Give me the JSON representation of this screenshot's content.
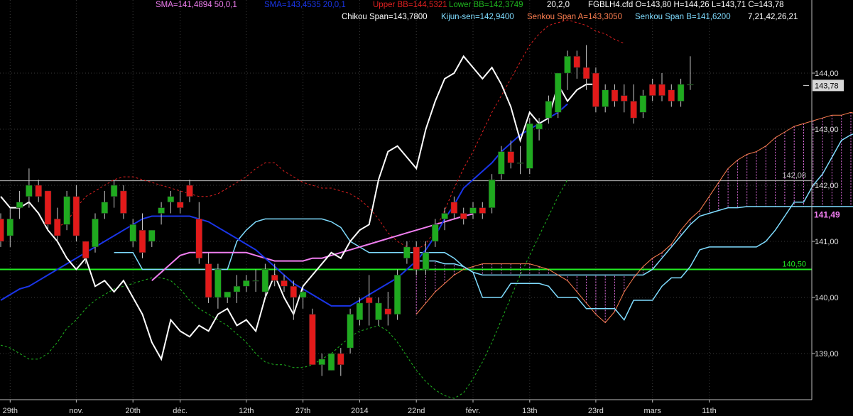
{
  "header": {
    "sma1": "SMA=141,4894  50,0,1",
    "sma2": "SMA=143,4535  20,0,1",
    "upper_bb": "Upper BB=144,5321",
    "lower_bb": "Lower BB=142,3749",
    "bb_params": "20,2,0",
    "ohlc": "FGBLH4.cfd O=143,80 H=144,26 L=143,71 C=143,78",
    "chikou": "Chikou Span=143,7800",
    "kijun": "Kijun-sen=142,9400",
    "senkou_a": "Senkou Span A=143,3050",
    "senkou_b": "Senkou Span B=141,6200",
    "ichimoku_params": "7,21,42,26,21"
  },
  "colors": {
    "background": "#000000",
    "up_candle": "#1faa1f",
    "down_candle": "#e21a1a",
    "sma50": "#f07ef0",
    "sma20": "#1a35e8",
    "upper_bb": "#e02020",
    "lower_bb": "#1fb51f",
    "chikou": "#ffffff",
    "kijun": "#7fdcff",
    "senkou_a": "#ff7f50",
    "senkou_b": "#7fdcff",
    "hline_green": "#22ee22",
    "hline_gray": "#c0c0c0",
    "cloud_fill": "#e06ee0"
  },
  "chart_data": {
    "type": "candlestick",
    "symbol": "FGBLH4.cfd",
    "y_range": [
      138.2,
      145.2
    ],
    "y_ticks": [
      "139,00",
      "140,00",
      "141,00",
      "142,00",
      "143,00",
      "144,00"
    ],
    "x_labels": [
      "29th",
      "nov.",
      "20th",
      "déc.",
      "12th",
      "27th",
      "2014",
      "22nd",
      "févr.",
      "13th",
      "23rd",
      "mars",
      "11th"
    ],
    "x_label_slots": [
      1,
      8,
      14,
      19,
      26,
      32,
      38,
      44,
      50,
      56,
      63,
      69,
      75
    ],
    "last_price": "143,78",
    "sma50_value_label": "141,49",
    "hlines": [
      {
        "value": 142.08,
        "label": "142,08",
        "color": "hline_gray"
      },
      {
        "value": 140.5,
        "label": "140,50",
        "color": "hline_green"
      }
    ],
    "candles": [
      [
        141.4,
        141.5,
        140.9,
        141.0
      ],
      [
        141.1,
        141.6,
        140.9,
        141.4
      ],
      [
        141.6,
        141.9,
        141.4,
        141.7
      ],
      [
        141.8,
        142.3,
        141.6,
        142.0
      ],
      [
        142.0,
        142.1,
        141.7,
        141.8
      ],
      [
        141.9,
        141.9,
        141.2,
        141.3
      ],
      [
        141.4,
        141.6,
        141.0,
        141.1
      ],
      [
        141.3,
        141.9,
        141.2,
        141.8
      ],
      [
        141.8,
        142.0,
        141.0,
        141.1
      ],
      [
        141.0,
        141.0,
        140.6,
        140.7
      ],
      [
        140.9,
        141.5,
        140.8,
        141.4
      ],
      [
        141.5,
        141.9,
        141.4,
        141.7
      ],
      [
        141.8,
        142.1,
        141.6,
        142.0
      ],
      [
        141.9,
        142.0,
        141.4,
        141.5
      ],
      [
        141.0,
        141.4,
        140.9,
        141.3
      ],
      [
        141.2,
        141.5,
        140.7,
        140.8
      ],
      [
        141.0,
        141.2,
        140.9,
        141.2
      ],
      [
        141.5,
        141.7,
        141.3,
        141.6
      ],
      [
        141.7,
        141.9,
        141.5,
        141.8
      ],
      [
        141.7,
        141.9,
        141.5,
        141.6
      ],
      [
        142.0,
        142.1,
        141.7,
        141.8
      ],
      [
        141.4,
        141.7,
        140.6,
        140.7
      ],
      [
        140.6,
        140.8,
        139.9,
        140.0
      ],
      [
        140.0,
        140.6,
        139.8,
        140.5
      ],
      [
        140.0,
        140.1,
        139.9,
        140.1
      ],
      [
        140.1,
        140.4,
        139.9,
        140.2
      ],
      [
        140.2,
        140.4,
        140.1,
        140.3
      ],
      [
        140.3,
        140.5,
        140.1,
        140.3
      ],
      [
        140.1,
        140.6,
        140.0,
        140.5
      ],
      [
        140.4,
        140.6,
        140.2,
        140.3
      ],
      [
        140.3,
        140.4,
        140.1,
        140.2
      ],
      [
        140.2,
        140.3,
        139.6,
        140.0
      ],
      [
        140.0,
        140.2,
        139.8,
        140.1
      ],
      [
        139.7,
        139.8,
        138.8,
        138.8
      ],
      [
        138.8,
        139.0,
        138.6,
        138.9
      ],
      [
        138.7,
        139.0,
        138.7,
        139.0
      ],
      [
        139.0,
        139.1,
        138.6,
        138.8
      ],
      [
        139.1,
        139.8,
        139.0,
        139.7
      ],
      [
        139.6,
        140.0,
        139.5,
        139.9
      ],
      [
        140.0,
        140.4,
        139.5,
        139.9
      ],
      [
        139.6,
        140.0,
        139.5,
        139.9
      ],
      [
        139.8,
        140.1,
        139.5,
        139.7
      ],
      [
        139.7,
        140.5,
        139.6,
        140.4
      ],
      [
        140.7,
        141.0,
        140.6,
        140.9
      ],
      [
        140.9,
        141.0,
        140.4,
        140.5
      ],
      [
        140.5,
        141.0,
        140.4,
        140.8
      ],
      [
        141.0,
        141.4,
        140.9,
        141.3
      ],
      [
        141.4,
        141.6,
        141.2,
        141.5
      ],
      [
        141.7,
        141.8,
        141.4,
        141.5
      ],
      [
        141.5,
        141.6,
        141.3,
        141.4
      ],
      [
        141.5,
        141.7,
        141.4,
        141.6
      ],
      [
        141.6,
        141.7,
        141.4,
        141.5
      ],
      [
        141.6,
        142.2,
        141.5,
        142.1
      ],
      [
        142.2,
        142.7,
        142.1,
        142.6
      ],
      [
        142.6,
        142.8,
        142.3,
        142.4
      ],
      [
        142.4,
        142.7,
        142.2,
        142.4
      ],
      [
        142.3,
        143.2,
        142.2,
        143.1
      ],
      [
        143.0,
        143.2,
        142.8,
        143.1
      ],
      [
        143.2,
        143.6,
        143.1,
        143.5
      ],
      [
        143.3,
        144.0,
        143.2,
        144.0
      ],
      [
        144.0,
        144.4,
        143.7,
        144.3
      ],
      [
        144.3,
        144.4,
        143.9,
        144.1
      ],
      [
        144.1,
        144.5,
        143.7,
        143.9
      ],
      [
        144.0,
        144.1,
        143.3,
        143.4
      ],
      [
        143.4,
        143.8,
        143.3,
        143.7
      ],
      [
        143.7,
        143.8,
        143.4,
        143.5
      ],
      [
        143.6,
        143.8,
        143.3,
        143.5
      ],
      [
        143.5,
        143.8,
        143.1,
        143.2
      ],
      [
        143.3,
        143.7,
        143.2,
        143.6
      ],
      [
        143.8,
        143.9,
        143.5,
        143.6
      ],
      [
        143.8,
        144.0,
        143.5,
        143.6
      ],
      [
        143.7,
        143.8,
        143.4,
        143.5
      ],
      [
        143.5,
        143.9,
        143.4,
        143.8
      ],
      [
        143.8,
        144.3,
        143.7,
        143.8
      ]
    ],
    "sma20": [
      139.95,
      140.05,
      140.15,
      140.2,
      140.3,
      140.4,
      140.5,
      140.6,
      140.7,
      140.8,
      140.9,
      141.0,
      141.1,
      141.2,
      141.3,
      141.4,
      141.45,
      141.45,
      141.45,
      141.45,
      141.45,
      141.4,
      141.35,
      141.25,
      141.15,
      141.05,
      140.95,
      140.85,
      140.7,
      140.55,
      140.4,
      140.25,
      140.15,
      140.05,
      139.95,
      139.85,
      139.85,
      139.85,
      139.95,
      140.05,
      140.15,
      140.25,
      140.35,
      140.5,
      140.65,
      140.85,
      141.1,
      141.4,
      141.65,
      141.95,
      142.1,
      142.25,
      142.4,
      142.6,
      142.75,
      142.9,
      143.0,
      143.1,
      143.2,
      143.3,
      143.45
    ],
    "sma50": [
      140.3,
      140.45,
      140.6,
      140.75,
      140.8,
      140.8,
      140.8,
      140.8,
      140.8,
      140.8,
      140.8,
      140.75,
      140.7,
      140.65,
      140.65,
      140.65,
      140.65,
      140.7,
      140.7,
      140.75,
      140.8,
      140.85,
      140.9,
      140.95,
      141.0,
      141.05,
      141.1,
      141.15,
      141.2,
      141.25,
      141.3,
      141.35,
      141.4,
      141.45,
      141.49
    ],
    "sma50_start": 16,
    "upper_bb": [
      141.25,
      141.35,
      141.6,
      141.8,
      141.9,
      142.0,
      142.1,
      142.15,
      142.15,
      142.1,
      142.05,
      142.0,
      141.95,
      141.9,
      141.85,
      141.8,
      141.8,
      141.85,
      141.95,
      142.05,
      142.15,
      142.3,
      142.4,
      142.4,
      142.25,
      142.15,
      142.05,
      142.0,
      141.95,
      141.95,
      141.9,
      141.85,
      141.75,
      141.6,
      141.4,
      141.15,
      141.0,
      140.9,
      140.85,
      140.95,
      141.2,
      141.55,
      141.95,
      142.3,
      142.6,
      142.95,
      143.3,
      143.6,
      143.9,
      144.2,
      144.5,
      144.7,
      144.85,
      144.9,
      144.95,
      144.9,
      144.85,
      144.75,
      144.7,
      144.6,
      144.53
    ],
    "lower_bb": [
      139.15,
      139.1,
      139.0,
      138.9,
      138.9,
      139.0,
      139.2,
      139.45,
      139.6,
      139.8,
      139.95,
      140.05,
      140.15,
      140.2,
      140.25,
      140.3,
      140.35,
      140.35,
      140.3,
      140.15,
      139.95,
      139.8,
      139.7,
      139.6,
      139.5,
      139.35,
      139.2,
      139.0,
      138.85,
      138.8,
      138.8,
      138.75,
      138.75,
      138.8,
      138.9,
      139.0,
      139.15,
      139.3,
      139.4,
      139.45,
      139.5,
      139.4,
      139.2,
      138.95,
      138.7,
      138.5,
      138.35,
      138.25,
      138.2,
      138.3,
      138.55,
      138.85,
      139.2,
      139.6,
      140.0,
      140.4,
      140.75,
      141.1,
      141.45,
      141.8,
      142.1
    ],
    "kijun": [
      140.8,
      140.8,
      140.8,
      140.5,
      140.5,
      140.5,
      140.5,
      140.5,
      140.5,
      140.5,
      140.5,
      140.5,
      140.5,
      141.0,
      141.2,
      141.35,
      141.4,
      141.4,
      141.4,
      141.4,
      141.4,
      141.4,
      141.4,
      141.35,
      141.25,
      141.0,
      140.9,
      140.8,
      140.8,
      140.8,
      140.8,
      140.8,
      140.8,
      140.8,
      140.8,
      140.8,
      140.7,
      140.55,
      140.45,
      140.0,
      140.0,
      140.0,
      140.25,
      140.25,
      140.25,
      140.25,
      140.2,
      140.0,
      140.0,
      140.0,
      139.8,
      139.8,
      139.8,
      139.8,
      139.6,
      139.95,
      139.95,
      139.95,
      140.2,
      140.35,
      140.35,
      140.55,
      140.85,
      140.9,
      140.9,
      140.9,
      140.9,
      140.9,
      140.9,
      141.0,
      141.2,
      141.45,
      141.7,
      141.7,
      142.0,
      142.2,
      142.5,
      142.8,
      142.9,
      142.95
    ],
    "kijun_start": 12,
    "senkou_a": [
      139.7,
      139.9,
      140.1,
      140.25,
      140.4,
      140.5,
      140.55,
      140.6,
      140.6,
      140.6,
      140.6,
      140.6,
      140.6,
      140.55,
      140.5,
      140.4,
      140.3,
      140.1,
      139.9,
      139.7,
      139.55,
      139.75,
      140.1,
      140.35,
      140.55,
      140.7,
      140.8,
      140.95,
      141.2,
      141.4,
      141.55,
      141.8,
      142.05,
      142.3,
      142.45,
      142.55,
      142.6,
      142.7,
      142.85,
      142.95,
      143.05,
      143.1,
      143.15,
      143.2,
      143.25,
      143.25,
      143.3,
      143.25,
      143.25,
      143.35
    ],
    "senkou_a_start": 44,
    "senkou_b": [
      140.65,
      140.65,
      140.65,
      140.6,
      140.6,
      140.55,
      140.45,
      140.4,
      140.4,
      140.4,
      140.4,
      140.4,
      140.4,
      140.4,
      140.4,
      140.4,
      140.4,
      140.4,
      140.4,
      140.4,
      140.4,
      140.4,
      140.4,
      140.4,
      140.4,
      140.5,
      140.7,
      140.9,
      141.1,
      141.3,
      141.45,
      141.5,
      141.55,
      141.6,
      141.6,
      141.62,
      141.62,
      141.62,
      141.62,
      141.62,
      141.62,
      141.62,
      141.62,
      141.62,
      141.62,
      141.62,
      141.62,
      141.62,
      141.62,
      141.62
    ],
    "senkou_b_start": 44,
    "chikou": [
      141.8,
      141.6,
      141.6,
      141.7,
      141.5,
      141.2,
      141.0,
      140.7,
      140.5,
      140.7,
      140.2,
      140.3,
      140.1,
      140.3,
      140.0,
      139.7,
      139.2,
      138.9,
      139.6,
      139.4,
      139.3,
      139.5,
      139.4,
      139.7,
      139.8,
      139.5,
      139.6,
      139.4,
      140.0,
      140.4,
      140.0,
      139.7,
      140.2,
      140.4,
      140.6,
      140.8,
      140.7,
      141.0,
      141.2,
      141.3,
      142.1,
      142.6,
      142.7,
      142.5,
      142.3,
      143.0,
      143.5,
      143.9,
      144.0,
      144.3,
      144.1,
      143.9,
      144.1,
      143.8,
      143.4,
      142.8,
      143.3,
      143.1,
      143.2,
      143.8,
      143.5,
      143.7,
      143.8,
      143.8
    ],
    "chikou_start": 0
  }
}
